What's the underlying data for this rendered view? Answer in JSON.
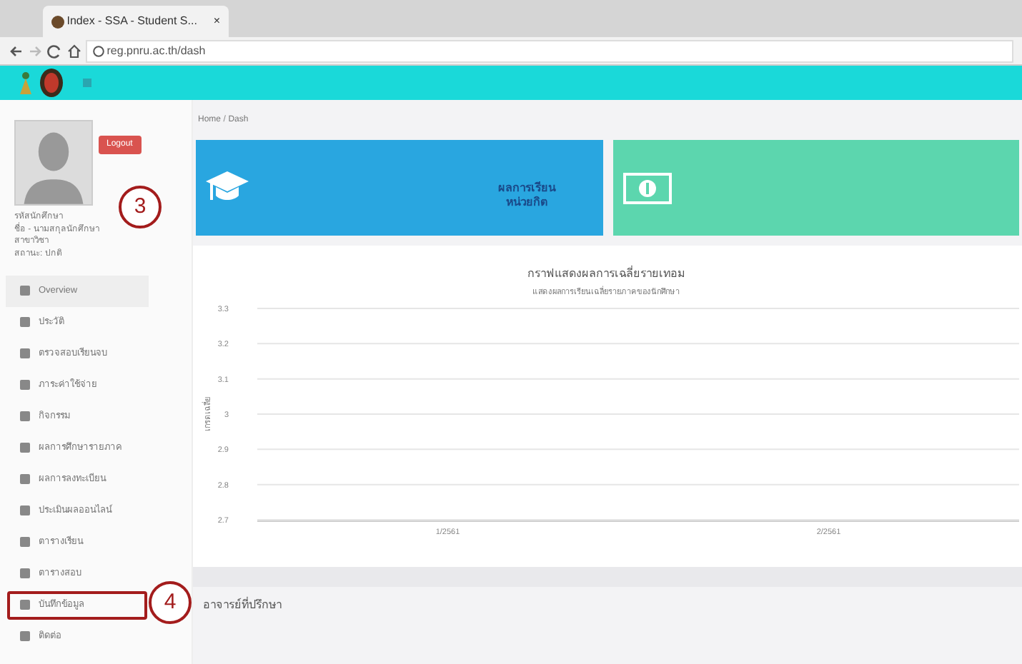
{
  "browser": {
    "tab_title": "Index - SSA - Student S...",
    "tab_close": "×",
    "address": "reg.pnru.ac.th/dash"
  },
  "sidebar": {
    "logout": "Logout",
    "profile_lines": [
      "รหัสนักศึกษา",
      "ชื่อ - นามสกุลนักศึกษา",
      "สาขาวิชา",
      "สถานะ: ปกติ"
    ],
    "items": [
      {
        "label": "Overview",
        "selected": true,
        "highlighted": false
      },
      {
        "label": "ประวัติ",
        "selected": false,
        "highlighted": false
      },
      {
        "label": "ตรวจสอบเรียนจบ",
        "selected": false,
        "highlighted": false
      },
      {
        "label": "ภาระค่าใช้จ่าย",
        "selected": false,
        "highlighted": false
      },
      {
        "label": "กิจกรรม",
        "selected": false,
        "highlighted": false
      },
      {
        "label": "ผลการศึกษารายภาค",
        "selected": false,
        "highlighted": false
      },
      {
        "label": "ผลการลงทะเบียน",
        "selected": false,
        "highlighted": false
      },
      {
        "label": "ประเมินผลออนไลน์",
        "selected": false,
        "highlighted": false
      },
      {
        "label": "ตารางเรียน",
        "selected": false,
        "highlighted": false
      },
      {
        "label": "ตารางสอบ",
        "selected": false,
        "highlighted": false
      },
      {
        "label": "บันทึกข้อมูล",
        "selected": false,
        "highlighted": true
      },
      {
        "label": "ติดต่อ",
        "selected": false,
        "highlighted": false
      }
    ]
  },
  "breadcrumb": {
    "items": [
      "Home",
      "Dash"
    ],
    "separator": "/"
  },
  "cards": [
    {
      "kind": "grade",
      "text": "ผลการเรียน หน่วยกิต"
    },
    {
      "kind": "money"
    }
  ],
  "chart": {
    "chart_data": {
      "type": "line",
      "grid": true,
      "title": "กราฟแสดงผลการเฉลี่ยรายเทอม",
      "subtitle": "แสดงผลการเรียนเฉลี่ยรายภาคของนักศึกษา",
      "ylabel": "เกรดเฉลี่ย",
      "categories": [
        "1/2561",
        "2/2561"
      ],
      "ylim": [
        2.7,
        3.3
      ],
      "yticks": [
        3.3,
        3.2,
        3.1,
        {
          "value": 3,
          "label": "3"
        },
        2.9,
        2.8,
        2.7
      ]
    }
  },
  "advisor": {
    "heading": "อาจารย์ที่ปรึกษา"
  },
  "annotations": [
    {
      "label": "3"
    },
    {
      "label": "4"
    }
  ]
}
